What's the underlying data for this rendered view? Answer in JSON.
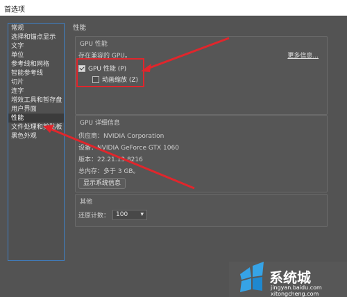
{
  "window": {
    "title": "首选项"
  },
  "sidebar": {
    "items": [
      {
        "label": "常规"
      },
      {
        "label": "选择和锚点显示"
      },
      {
        "label": "文字"
      },
      {
        "label": "单位"
      },
      {
        "label": "参考线和网格"
      },
      {
        "label": "智能参考线"
      },
      {
        "label": "切片"
      },
      {
        "label": "连字"
      },
      {
        "label": "增效工具和暂存盘"
      },
      {
        "label": "用户界面"
      },
      {
        "label": "性能"
      },
      {
        "label": "文件处理和剪贴板"
      },
      {
        "label": "黑色外观"
      }
    ],
    "active_index": 10
  },
  "main": {
    "heading": "性能",
    "gpu_performance": {
      "title": "GPU 性能",
      "compat_text": "存在兼容的 GPU。",
      "more_info": "更多信息...",
      "gpu_checkbox_label": "GPU 性能 (P)",
      "gpu_checked": true,
      "anim_checkbox_label": "动画缩放 (Z)",
      "anim_checked": false
    },
    "gpu_details": {
      "title": "GPU 详细信息",
      "vendor": "供应商：NVIDIA Corporation",
      "device": "设备：NVIDIA GeForce GTX 1060",
      "version": "版本：22.21.13.8216",
      "memory": "总内存：多于 3 GB。",
      "show_info_button": "显示系统信息"
    },
    "other": {
      "title": "其他",
      "undo_label": "还原计数：",
      "undo_value": "100"
    }
  },
  "watermark": {
    "site": "jingyan.baidu.com",
    "site2": "xitongcheng.com"
  },
  "colors": {
    "annotation_red": "#e0262c",
    "sidebar_border": "#3f7fc4",
    "background": "#535353"
  }
}
